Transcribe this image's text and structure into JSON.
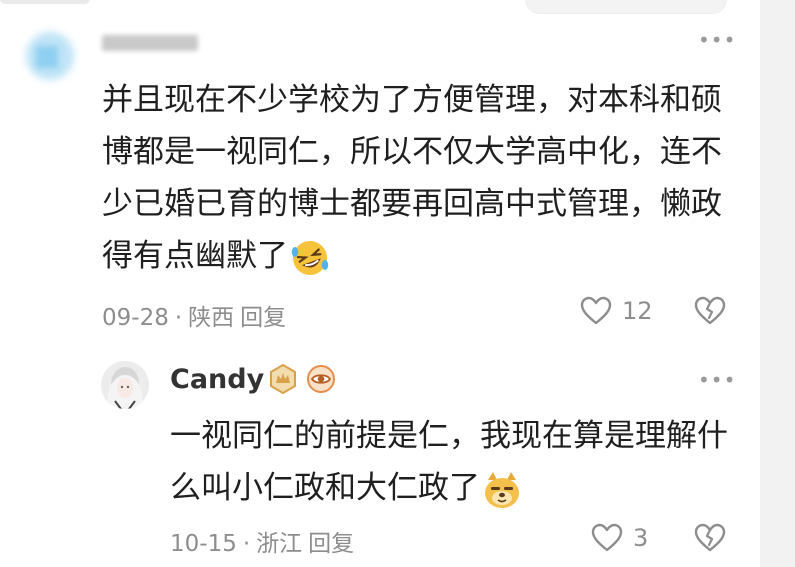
{
  "comments": [
    {
      "author": "",
      "text": "并且现在不少学校为了方便管理，对本科和硕博都是一视同仁，所以不仅大学高中化，连不少已婚已育的博士都要再回高中式管理，懒政得有点幽默了",
      "emoji": "rofl-emoji",
      "date": "09-28",
      "separator": "·",
      "location": "陕西",
      "reply_label": "回复",
      "likes": "12",
      "more_label": "•••"
    },
    {
      "author": "Candy",
      "badges": [
        "level-badge",
        "eye-badge"
      ],
      "text": "一视同仁的前提是仁，我现在算是理解什么叫小仁政和大仁政了",
      "emoji": "doge-emoji",
      "date": "10-15",
      "separator": "·",
      "location": "浙江",
      "reply_label": "回复",
      "likes": "3",
      "more_label": "•••"
    }
  ],
  "colors": {
    "text": "#1f1f1f",
    "meta": "#8d8d8d",
    "badge_gold": "#d9a24a",
    "emoji_yellow": "#f6c33b"
  }
}
